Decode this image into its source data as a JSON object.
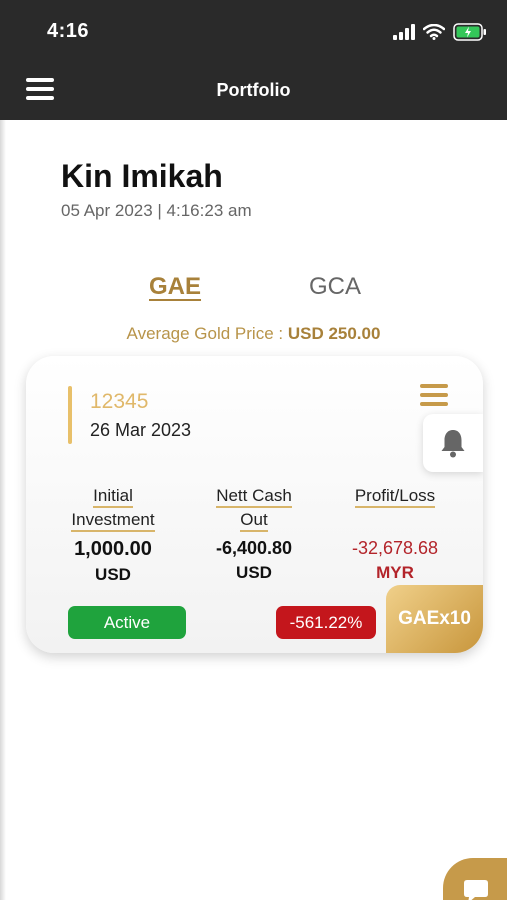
{
  "status": {
    "time": "4:16"
  },
  "header": {
    "title": "Portfolio"
  },
  "user": {
    "name": "Kin Imikah",
    "timestamp": "05 Apr 2023 | 4:16:23 am"
  },
  "tabs": [
    {
      "label": "GAE",
      "active": true
    },
    {
      "label": "GCA",
      "active": false
    }
  ],
  "average_price": {
    "label": "Average Gold Price :",
    "value": "USD 250.00"
  },
  "card": {
    "account_no": "12345",
    "date": "26 Mar 2023",
    "columns": [
      {
        "label_line1": "Initial",
        "label_line2": "Investment",
        "value": "1,000.00",
        "currency": "USD"
      },
      {
        "label_line1": "Nett Cash",
        "label_line2": "Out",
        "value": "-6,400.80",
        "currency": "USD"
      },
      {
        "label_line1": "Profit/Loss",
        "label_line2": "",
        "value": "-32,678.68",
        "currency": "MYR"
      }
    ],
    "status": "Active",
    "percent": "-561.22%",
    "tag": "GAEx10"
  },
  "colors": {
    "gold": "#c69a4a",
    "active": "#1fa33d",
    "loss": "#c4161c",
    "topbar": "#2a2a2a"
  },
  "icons": [
    "menu-icon",
    "signal-icon",
    "wifi-icon",
    "battery-icon",
    "bell-icon",
    "chat-icon"
  ]
}
